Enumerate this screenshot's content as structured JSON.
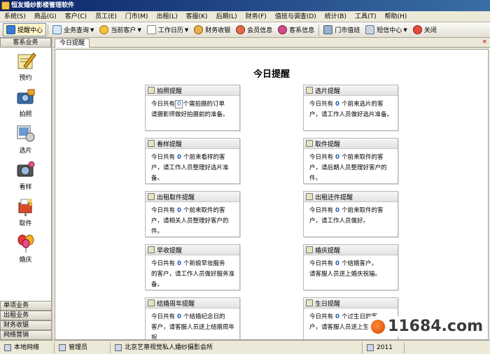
{
  "window": {
    "title": "恒友婚纱影楼管理软件"
  },
  "menu": [
    "系统(S)",
    "商品(G)",
    "客户(C)",
    "员工(E)",
    "门市(M)",
    "出租(L)",
    "客服(K)",
    "后期(L)",
    "财务(F)",
    "值班与调查(D)",
    "统计(B)",
    "工具(T)",
    "帮助(H)"
  ],
  "toolbar": {
    "reminder_center": "提醒中心",
    "business_query": "业务查询",
    "current_customer": "当前客户",
    "work_calendar": "工作日历",
    "finance_collect": "财务收银",
    "member_info": "会员信息",
    "service_info": "客系信息",
    "store_duty": "门市值班",
    "sms_center": "短信中心",
    "close": "关闭"
  },
  "sidebar": {
    "header": "客系业务",
    "items": [
      "预约",
      "拍照",
      "选片",
      "看样",
      "取件",
      "婚庆"
    ],
    "bottom_tabs": [
      "单项业务",
      "出租业务",
      "财务收银",
      "网络营销"
    ]
  },
  "main": {
    "tab_label": "今日提醒",
    "tab_close": "×",
    "title": "今日提醒"
  },
  "cards": [
    {
      "title": "拍照提醒",
      "pre": "今日共有",
      "count": "0",
      "post": "个需拍摄的订单",
      "line2": "请摄影师做好拍摄前的准备。",
      "boxed": true
    },
    {
      "title": "选片提醒",
      "pre": "今日共有",
      "count": "0",
      "post": "个前来选片的客",
      "line2": "户，请工作人员做好选片准备。",
      "boxed": false
    },
    {
      "title": "看样提醒",
      "pre": "今日共有",
      "count": "0",
      "post": "个前来看样的客",
      "line2": "户，请工作人员整理好选片准备。",
      "boxed": false
    },
    {
      "title": "取件提醒",
      "pre": "今日共有",
      "count": "0",
      "post": "个前来取件的客",
      "line2": "户，请后期人员整理好客户的件。",
      "boxed": false
    },
    {
      "title": "出租取件提醒",
      "pre": "今日共有",
      "count": "0",
      "post": "个前来取件的客",
      "line2": "户，请相关人员整理好客户的件。",
      "boxed": false
    },
    {
      "title": "出租还件提醒",
      "pre": "今日共有",
      "count": "0",
      "post": "个前来取件的客",
      "line2": "户，请工作人员做好。",
      "boxed": false
    },
    {
      "title": "早收提醒",
      "pre": "今日共有",
      "count": "0",
      "post": "个新娘早妆服务",
      "line2": "的客户，请工作人员做好服务准备。",
      "boxed": false
    },
    {
      "title": "婚庆提醒",
      "pre": "今日共有",
      "count": "0",
      "post": "个结婚客户，",
      "line2": "请客服人员送上婚庆祝福。",
      "boxed": false
    },
    {
      "title": "结婚周年提醒",
      "pre": "今日共有",
      "count": "0",
      "post": "个结婚纪念日的",
      "line2": "客户，请客服人员送上结婚周年祝",
      "boxed": false
    },
    {
      "title": "生日提醒",
      "pre": "今日共有",
      "count": "0",
      "post": "个过生日的客",
      "line2": "户，请客服人员送上生日祝福。",
      "boxed": false
    }
  ],
  "status": {
    "location": "本地网络",
    "user": "管理员",
    "company": "北京艺蒂视觉私人婚纱摄影会所",
    "date": "2011"
  },
  "watermark": "11684.com",
  "colors": {
    "titlebar": "#0a246a",
    "count_blue": "#1a5bb8",
    "menu_bg": "#ece9d8"
  }
}
